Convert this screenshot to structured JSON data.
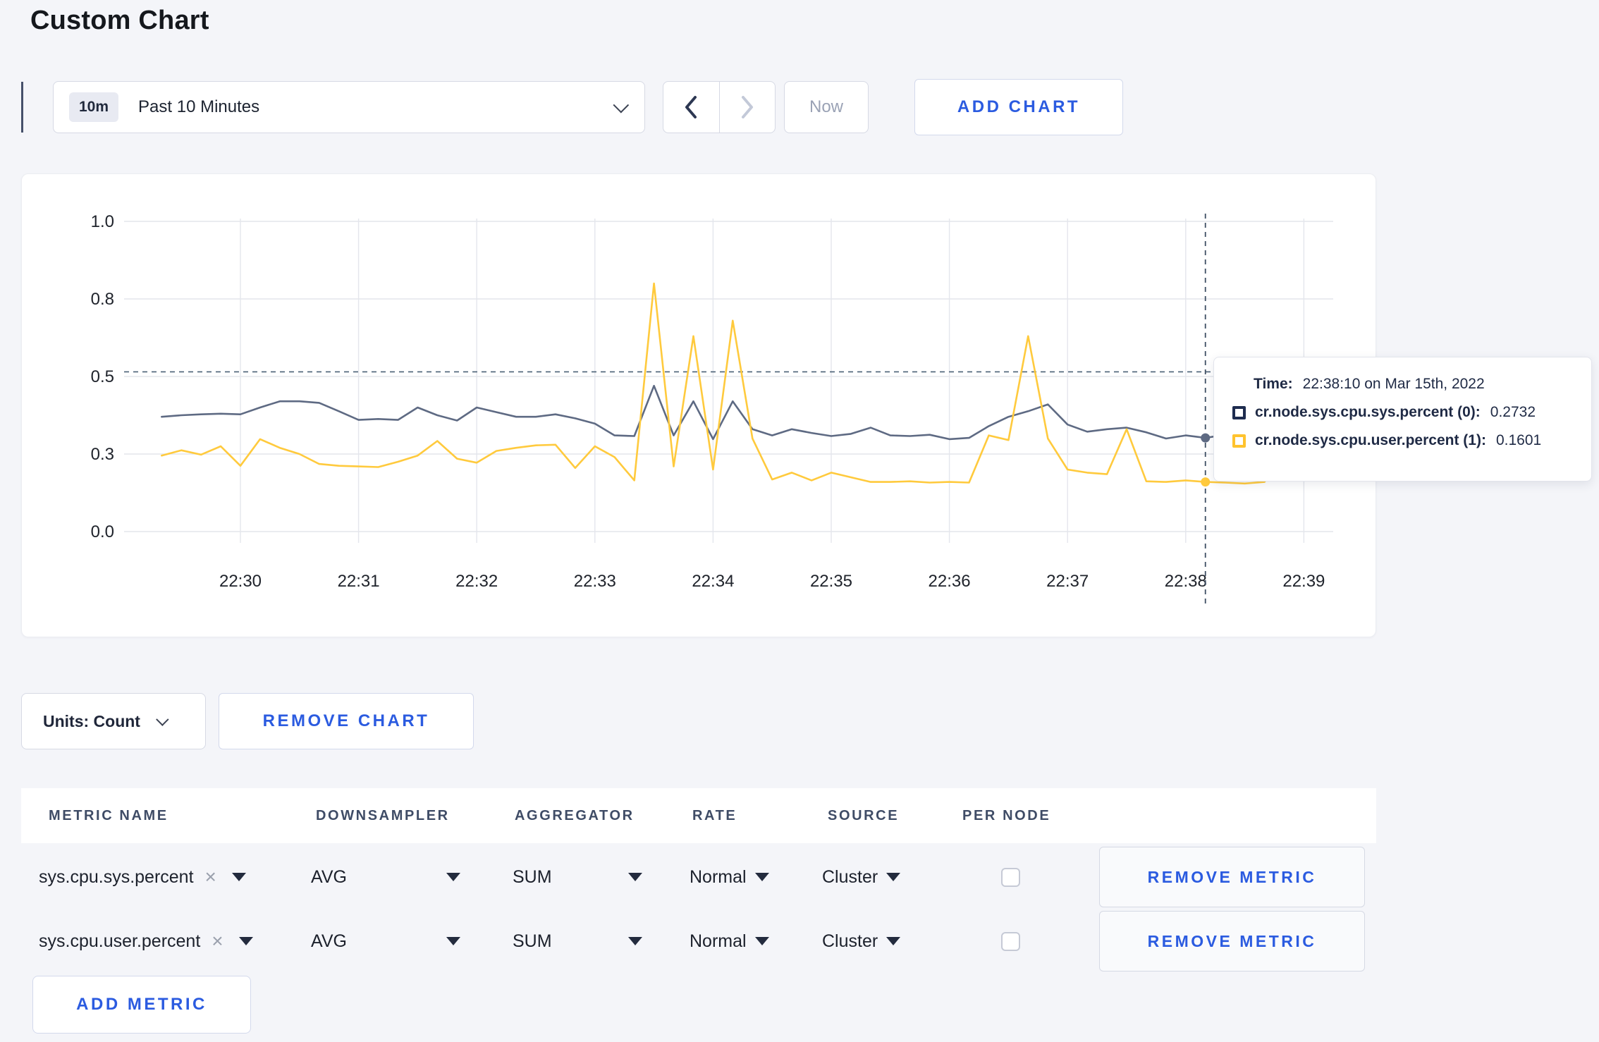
{
  "page": {
    "title": "Custom Chart",
    "background": "#f4f5f9"
  },
  "toolbar": {
    "time_window_badge": "10m",
    "time_window_label": "Past 10 Minutes",
    "now_label": "Now",
    "add_chart_label": "ADD CHART"
  },
  "chart_data": {
    "type": "line",
    "title": "",
    "xlabel": "",
    "ylabel": "",
    "ylim": [
      0,
      1
    ],
    "grid": true,
    "legend_position": "tooltip",
    "x_axis": {
      "tick_labels": [
        "22:30",
        "22:31",
        "22:32",
        "22:33",
        "22:34",
        "22:35",
        "22:36",
        "22:37",
        "22:38",
        "22:39"
      ],
      "tick_seconds": [
        0,
        60,
        120,
        180,
        240,
        300,
        360,
        420,
        480,
        540
      ]
    },
    "y_axis": {
      "tick_labels": [
        "0.0",
        "0.3",
        "0.5",
        "0.8",
        "1.0"
      ],
      "tick_values": [
        0,
        0.25,
        0.5,
        0.75,
        1.0
      ]
    },
    "x_seconds": [
      -40,
      -30,
      -20,
      -10,
      0,
      10,
      20,
      30,
      40,
      50,
      60,
      70,
      80,
      90,
      100,
      110,
      120,
      130,
      140,
      150,
      160,
      170,
      180,
      190,
      200,
      210,
      220,
      230,
      240,
      250,
      260,
      270,
      280,
      290,
      300,
      310,
      320,
      330,
      340,
      350,
      360,
      370,
      380,
      390,
      400,
      410,
      420,
      430,
      440,
      450,
      460,
      470,
      480,
      490,
      500,
      510,
      520,
      530,
      540,
      550
    ],
    "series": [
      {
        "name": "cr.node.sys.cpu.sys.percent (0)",
        "color": "#5e6a83",
        "values": [
          0.37,
          0.375,
          0.378,
          0.38,
          0.378,
          0.4,
          0.42,
          0.42,
          0.415,
          0.388,
          0.36,
          0.363,
          0.36,
          0.4,
          0.375,
          0.358,
          0.4,
          0.385,
          0.37,
          0.37,
          0.378,
          0.365,
          0.348,
          0.31,
          0.308,
          0.47,
          0.31,
          0.42,
          0.298,
          0.42,
          0.33,
          0.31,
          0.33,
          0.318,
          0.308,
          0.315,
          0.335,
          0.31,
          0.308,
          0.312,
          0.298,
          0.302,
          0.34,
          0.37,
          0.388,
          0.41,
          0.345,
          0.322,
          0.33,
          0.335,
          0.32,
          0.3,
          0.31,
          0.302,
          0.312,
          0.29,
          0.302,
          0.31,
          0.3,
          0.312
        ]
      },
      {
        "name": "cr.node.sys.cpu.user.percent (1)",
        "color": "#ffca3d",
        "values": [
          0.245,
          0.262,
          0.248,
          0.275,
          0.212,
          0.298,
          0.27,
          0.25,
          0.218,
          0.212,
          0.21,
          0.208,
          0.225,
          0.245,
          0.292,
          0.235,
          0.222,
          0.26,
          0.27,
          0.278,
          0.28,
          0.205,
          0.275,
          0.24,
          0.165,
          0.8,
          0.21,
          0.63,
          0.2,
          0.68,
          0.3,
          0.168,
          0.19,
          0.165,
          0.19,
          0.175,
          0.16,
          0.16,
          0.162,
          0.158,
          0.16,
          0.158,
          0.31,
          0.295,
          0.63,
          0.3,
          0.2,
          0.19,
          0.185,
          0.33,
          0.162,
          0.16,
          0.165,
          0.16,
          0.158,
          0.155,
          0.16,
          0.24,
          0.27,
          0.25
        ]
      }
    ],
    "crosshair": {
      "x_seconds": 490,
      "hline_value": 0.515
    }
  },
  "tooltip": {
    "time_label": "Time:",
    "time_value": "22:38:10 on Mar 15th, 2022",
    "entries": [
      {
        "label": "cr.node.sys.cpu.sys.percent (0):",
        "value": "0.2732",
        "swatch_color": "#1e2c4f"
      },
      {
        "label": "cr.node.sys.cpu.user.percent (1):",
        "value": "0.1601",
        "swatch_color": "#ffc32e"
      }
    ]
  },
  "chart_controls": {
    "units_label": "Units: Count",
    "remove_chart_label": "REMOVE CHART"
  },
  "metrics_table": {
    "headers": [
      "METRIC NAME",
      "DOWNSAMPLER",
      "AGGREGATOR",
      "RATE",
      "SOURCE",
      "PER NODE"
    ],
    "rows": [
      {
        "metric_name": "sys.cpu.sys.percent",
        "clear": "×",
        "downsampler": "AVG",
        "aggregator": "SUM",
        "rate": "Normal",
        "source": "Cluster",
        "per_node_checked": false,
        "remove_label": "REMOVE METRIC"
      },
      {
        "metric_name": "sys.cpu.user.percent",
        "clear": "×",
        "downsampler": "AVG",
        "aggregator": "SUM",
        "rate": "Normal",
        "source": "Cluster",
        "per_node_checked": false,
        "remove_label": "REMOVE METRIC"
      }
    ],
    "add_metric_label": "ADD METRIC"
  },
  "colors": {
    "accent_blue": "#2b5be0",
    "gridline": "#e4e6ec",
    "axis_text": "#20242c",
    "crosshair": "#4a6076"
  }
}
